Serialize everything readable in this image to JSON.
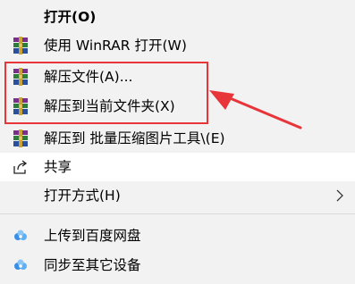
{
  "menu": {
    "items": [
      {
        "label": "打开(O)",
        "icon": "none",
        "bold": true
      },
      {
        "label": "使用 WinRAR 打开(W)",
        "icon": "winrar-icon"
      },
      {
        "label": "解压文件(A)...",
        "icon": "winrar-icon"
      },
      {
        "label": "解压到当前文件夹(X)",
        "icon": "winrar-icon"
      },
      {
        "label": "解压到 批量压缩图片工具\\(E)",
        "icon": "winrar-icon"
      },
      {
        "label": "共享",
        "icon": "share-icon"
      },
      {
        "label": "打开方式(H)",
        "icon": "none",
        "submenu": true
      },
      {
        "label": "上传到百度网盘",
        "icon": "baidu-netdisk-icon"
      },
      {
        "label": "同步至其它设备",
        "icon": "baidu-netdisk-icon"
      }
    ]
  },
  "annotation": {
    "highlight_color": "#e8353a"
  },
  "colors": {
    "menu_background": "#f2f2f2",
    "selected_background": "#ffffff",
    "separator": "#dadada"
  }
}
